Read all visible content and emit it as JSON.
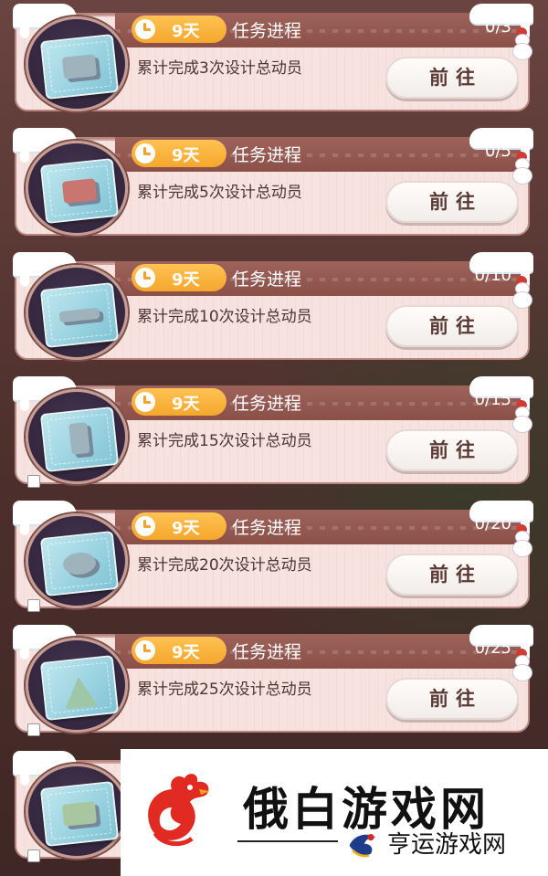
{
  "tasks": [
    {
      "timer": "9天",
      "progress_label": "任务进程",
      "progress": "0/3",
      "description": "累计完成3次设计总动员",
      "button": "前往"
    },
    {
      "timer": "9天",
      "progress_label": "任务进程",
      "progress": "0/5",
      "description": "累计完成5次设计总动员",
      "button": "前往"
    },
    {
      "timer": "9天",
      "progress_label": "任务进程",
      "progress": "0/10",
      "description": "累计完成10次设计总动员",
      "button": "前往"
    },
    {
      "timer": "9天",
      "progress_label": "任务进程",
      "progress": "0/15",
      "description": "累计完成15次设计总动员",
      "button": "前往"
    },
    {
      "timer": "9天",
      "progress_label": "任务进程",
      "progress": "0/20",
      "description": "累计完成20次设计总动员",
      "button": "前往"
    },
    {
      "timer": "9天",
      "progress_label": "任务进程",
      "progress": "0/25",
      "description": "累计完成25次设计总动员",
      "button": "前往"
    },
    {
      "timer": "",
      "progress_label": "",
      "progress": "",
      "description": "",
      "button": ""
    }
  ],
  "watermark": {
    "title": "俄白游戏网",
    "subtitle": "亨运游戏网"
  },
  "colors": {
    "band": "#8b5149",
    "timer_badge": "#f5a72c",
    "card_bg": "#f6e3df",
    "button_text": "#5b3a36"
  }
}
